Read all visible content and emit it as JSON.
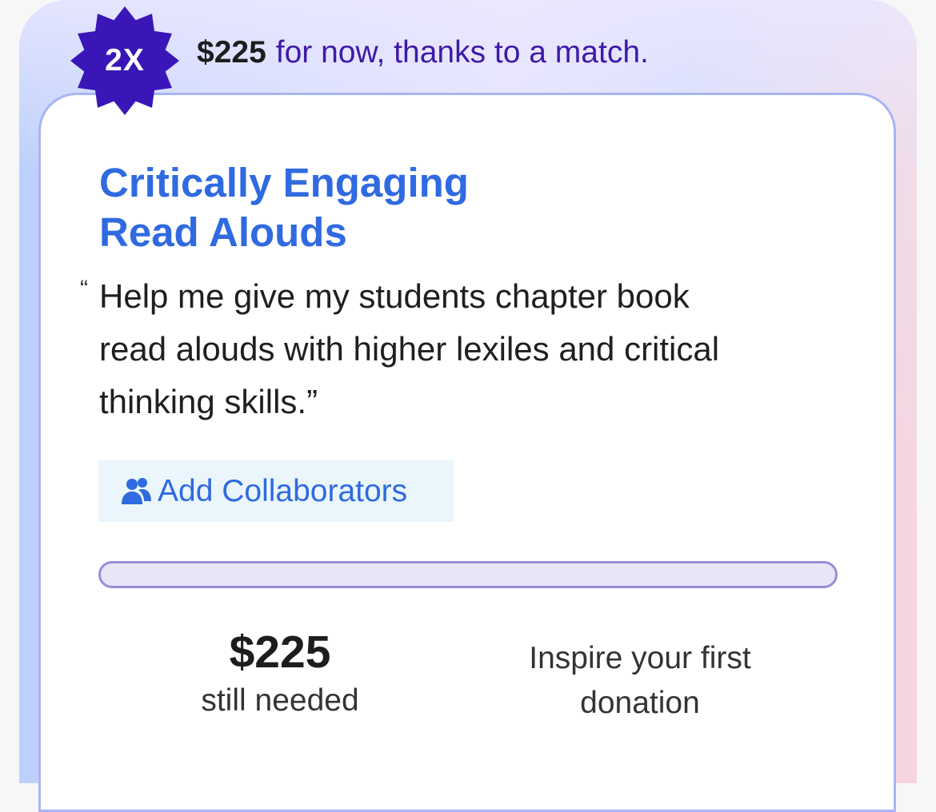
{
  "match": {
    "badge_text": "2X",
    "amount": "$225",
    "text": "for now, thanks to a match."
  },
  "project": {
    "title_line1": "Critically Engaging",
    "title_line2": "Read Alouds",
    "quote_line1": "Help me give my students chapter book",
    "quote_line2": "read alouds with higher lexiles and critical",
    "quote_line3": "thinking skills.”"
  },
  "collaborators": {
    "label": "Add Collaborators",
    "icon": "people-icon"
  },
  "progress": {
    "percent": 0
  },
  "stats": {
    "amount_needed": "$225",
    "amount_label": "still needed",
    "cta_line1": "Inspire your first",
    "cta_line2": "donation"
  },
  "colors": {
    "badge": "#3a16b8",
    "title": "#2f6ae0",
    "progress_border": "#9c8bd8",
    "progress_track": "#e9e5f8"
  }
}
